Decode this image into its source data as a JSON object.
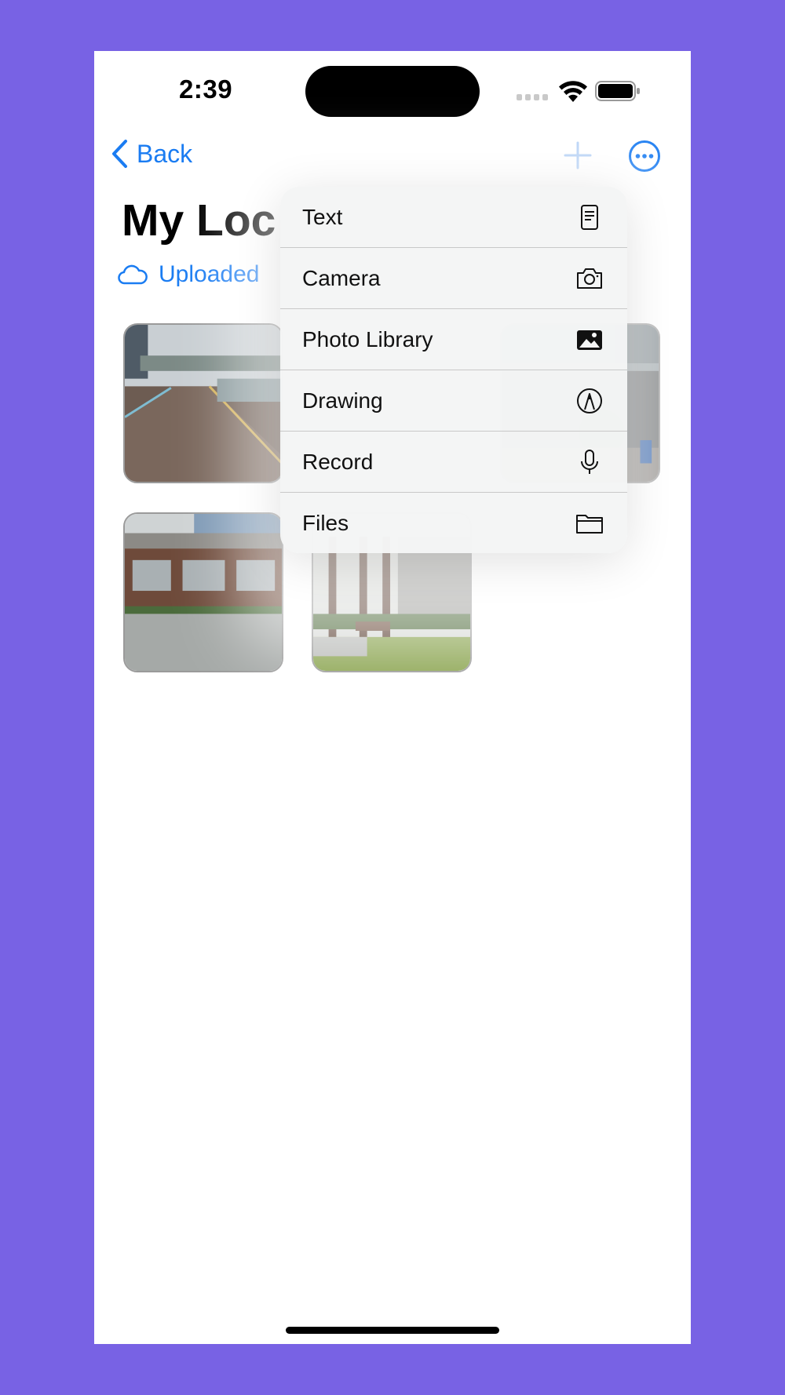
{
  "status_bar": {
    "time": "2:39"
  },
  "nav": {
    "back_label": "Back",
    "add_icon": "plus-icon",
    "more_icon": "ellipsis-circle-icon"
  },
  "page": {
    "title": "My Loc",
    "upload_status": "Uploaded",
    "upload_icon": "cloud-icon"
  },
  "accent_color": "#1a7cf2",
  "background_color": "#7862E4",
  "photos": [
    {
      "name": "waterfront-boardwalk"
    },
    {
      "name": "building-under-bridge"
    },
    {
      "name": "plaza-building"
    },
    {
      "name": "trees-bench"
    }
  ],
  "menu": {
    "items": [
      {
        "label": "Text",
        "icon": "text-document-icon"
      },
      {
        "label": "Camera",
        "icon": "camera-icon"
      },
      {
        "label": "Photo Library",
        "icon": "photo-icon"
      },
      {
        "label": "Drawing",
        "icon": "pencil-tip-circle-icon"
      },
      {
        "label": "Record",
        "icon": "microphone-icon"
      },
      {
        "label": "Files",
        "icon": "folder-icon"
      }
    ]
  }
}
